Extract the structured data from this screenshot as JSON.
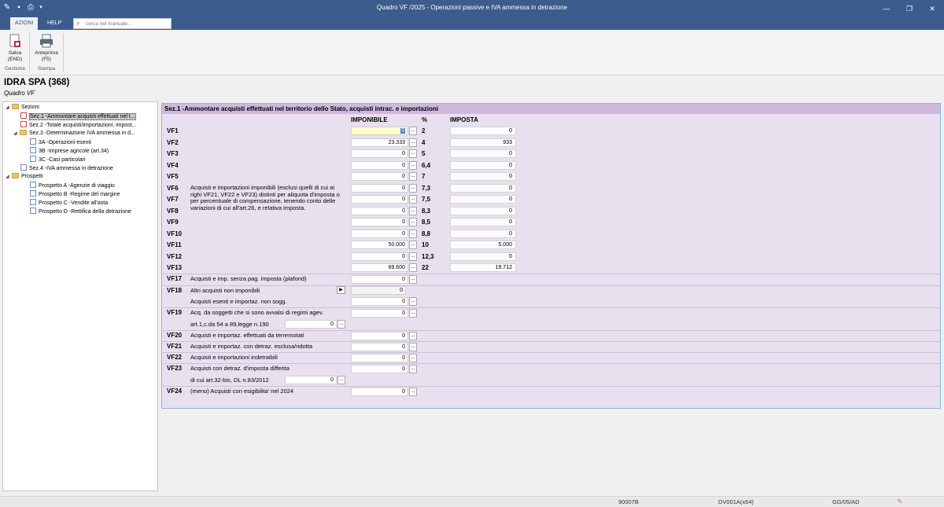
{
  "window": {
    "title": "Quadro VF /2025 - Operazioni passive e IVA ammessa in detrazione"
  },
  "ribbon": {
    "tabs": [
      "AZIONI",
      "HELP"
    ],
    "search_placeholder": "cerca nel manuale...",
    "buttons": {
      "save": {
        "line1": "Salva",
        "line2": "(END)"
      },
      "preview": {
        "line1": "Anteprima",
        "line2": "(F5)"
      }
    },
    "groups": [
      "Gestione",
      "Stampa"
    ]
  },
  "company": {
    "name": "IDRA SPA (368)",
    "subtitle": "Quadro VF"
  },
  "tree": {
    "root": "Sezioni",
    "items": [
      "Sez.1 -Ammontare acquisti effettuati nel t...",
      "Sez.2 -Totale acquisti/importazioni, impost...",
      "Sez.3 -Determinazione IVA ammessa in d...",
      "3A -Operazioni esenti",
      "3B -Imprese agricole (art.34)",
      "3C -Casi particolari",
      "Sez.4 -IVA ammessa in detrazione"
    ],
    "root2": "Prospetti",
    "items2": [
      "Prospetto A -Agenzie di viaggio",
      "Prospetto B -Regime del margine",
      "Prospetto C -Vendite all'asta",
      "Prospetto D -Rettifica della detrazione"
    ]
  },
  "panel": {
    "header": "Sez.1 -Ammontare acquisti effettuati nel territorio dello Stato, acquisti intrac. e importazioni",
    "col_imponibile": "IMPONIBILE",
    "col_pct": "%",
    "col_imposta": "IMPOSTA",
    "vf_desc": "Acquisti e importazioni imponibili (esclusi quelli di cui ai righi VF21, VF22 e VF23) distinti per aliquota d'imposta o per percentuale di compensazione, tenendo conto delle variazioni di cui all'art.26, e relativa imposta.",
    "rows": [
      {
        "code": "VF1",
        "imponibile": "0",
        "pct": "2",
        "imposta": "0"
      },
      {
        "code": "VF2",
        "imponibile": "23.333",
        "pct": "4",
        "imposta": "933"
      },
      {
        "code": "VF3",
        "imponibile": "0",
        "pct": "5",
        "imposta": "0"
      },
      {
        "code": "VF4",
        "imponibile": "0",
        "pct": "6,4",
        "imposta": "0"
      },
      {
        "code": "VF5",
        "imponibile": "0",
        "pct": "7",
        "imposta": "0"
      },
      {
        "code": "VF6",
        "imponibile": "0",
        "pct": "7,3",
        "imposta": "0"
      },
      {
        "code": "VF7",
        "imponibile": "0",
        "pct": "7,5",
        "imposta": "0"
      },
      {
        "code": "VF8",
        "imponibile": "0",
        "pct": "8,3",
        "imposta": "0"
      },
      {
        "code": "VF9",
        "imponibile": "0",
        "pct": "8,5",
        "imposta": "0"
      },
      {
        "code": "VF10",
        "imponibile": "0",
        "pct": "8,8",
        "imposta": "0"
      },
      {
        "code": "VF11",
        "imponibile": "50.000",
        "pct": "10",
        "imposta": "5.000"
      },
      {
        "code": "VF12",
        "imponibile": "0",
        "pct": "12,3",
        "imposta": "0"
      },
      {
        "code": "VF13",
        "imponibile": "89.600",
        "pct": "22",
        "imposta": "19.712"
      }
    ],
    "vf17": {
      "code": "VF17",
      "desc": "Acquisti e imp. senza pag. imposta (plafond)",
      "value": "0"
    },
    "vf18": {
      "code": "VF18",
      "desc1": "Altri acquisti non imponibili",
      "value1": "0",
      "desc2": "Acquisti esenti e importaz. non sogg.",
      "value2": "0"
    },
    "vf19": {
      "code": "VF19",
      "desc1": "Acq. da soggetti che si sono avvalsi di regimi agev.",
      "value1": "0",
      "desc2": "art.1,c.da 54 a 89,legge n.190",
      "value2": "0"
    },
    "vf20": {
      "code": "VF20",
      "desc": "Acquisti e importaz. effettuati da terremotati",
      "value": "0"
    },
    "vf21": {
      "code": "VF21",
      "desc": "Acquisti e importaz. con detraz. esclusa/ridotta",
      "value": "0"
    },
    "vf22": {
      "code": "VF22",
      "desc": "Acquisti e importazioni indetraibili",
      "value": "0"
    },
    "vf23": {
      "code": "VF23",
      "desc1": "Acquisti con detraz. d'imposta differita",
      "value1": "0",
      "desc2": "di cui art.32-bis, DL n.83/2012",
      "value2": "0"
    },
    "vf24": {
      "code": "VF24",
      "desc": "(meno) Acquisti con esigibilita' nel 2024",
      "value": "0"
    }
  },
  "status": {
    "code": "90007B",
    "version": "DV001A(x64)",
    "date_format": "GG/05/AD"
  }
}
